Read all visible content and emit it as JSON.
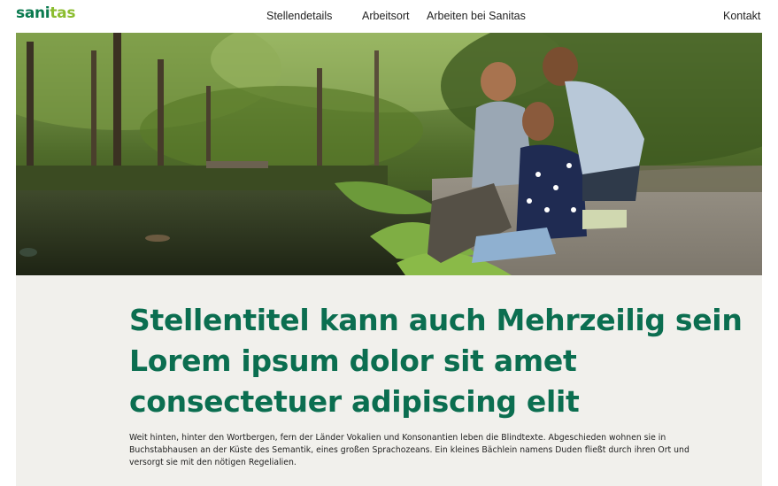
{
  "brand": {
    "logo_part1": "sani",
    "logo_part2": "tas",
    "color_primary": "#0b6e50",
    "color_secondary": "#8bbd2f"
  },
  "nav": {
    "items": [
      {
        "label": "Stellendetails"
      },
      {
        "label": "Arbeitsort"
      },
      {
        "label": "Arbeiten bei Sanitas"
      },
      {
        "label": "Kontakt"
      }
    ]
  },
  "hero": {
    "image_alt": "family-by-forest-pond-photo"
  },
  "job": {
    "title_lines": [
      "Stellentitel kann auch Mehrzeilig sein",
      "Lorem ipsum dolor sit amet",
      "consectetuer adipiscing elit"
    ],
    "description": "Weit hinten, hinter den Wortbergen, fern der Länder Vokalien und Konsonantien leben die Blindtexte. Abgeschieden wohnen sie in Buchstabhausen an der Küste des Semantik, eines großen Sprachozeans. Ein kleines Bächlein namens Duden fließt durch ihren Ort und versorgt sie mit den nötigen Regelialien."
  }
}
